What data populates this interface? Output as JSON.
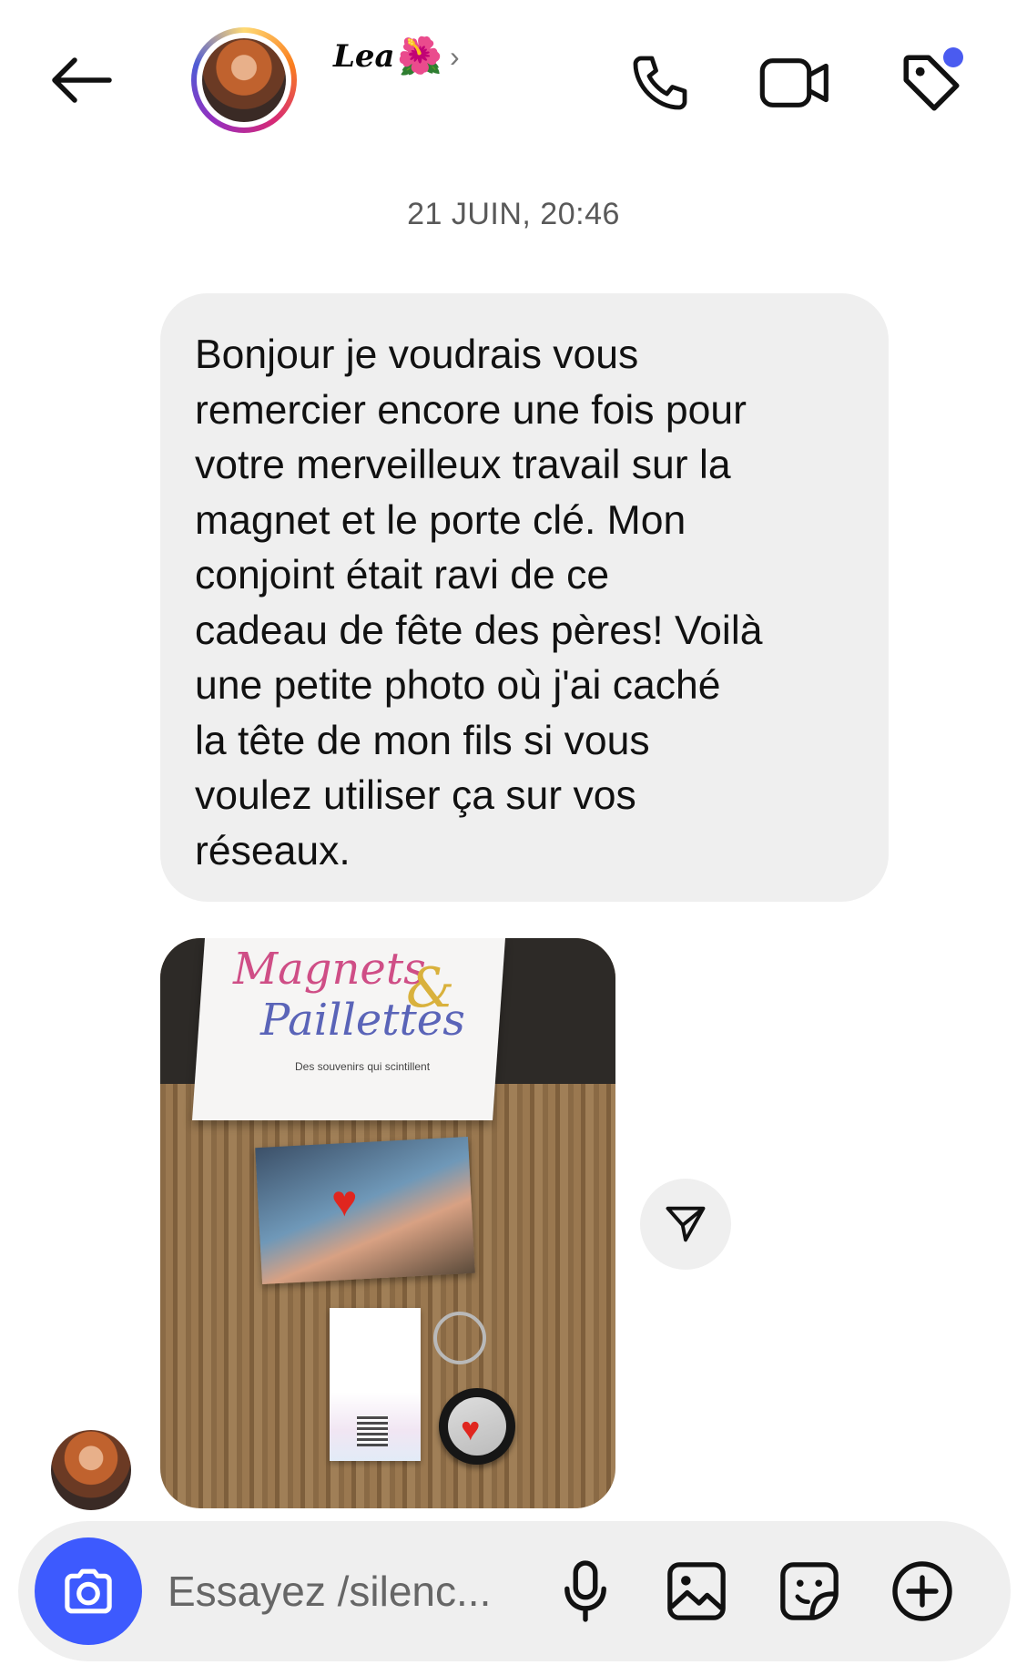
{
  "header": {
    "contact_name": "Lea",
    "name_emoji": "🌺",
    "chevron": "›",
    "icons": [
      "back-arrow-icon",
      "phone-icon",
      "video-camera-icon",
      "tag-icon"
    ],
    "notification_dot_color": "#4a5bf0"
  },
  "thread": {
    "timestamp": "21 JUIN, 20:46",
    "message_text": "Bonjour je voudrais vous\nremercier encore une fois pour\nvotre merveilleux travail sur la\nmagnet et le porte clé. Mon\nconjoint était ravi de ce\ncadeau de fête des pères! Voilà\nune petite photo où j'ai caché\nla tête de mon fils si vous\nvoulez utiliser ça sur vos\nréseaux.",
    "photo": {
      "brand_line1": "Magnets",
      "brand_amp": "&",
      "brand_line2": "Paillettes",
      "brand_tagline": "Des souvenirs qui scintillent",
      "heart": "♥"
    }
  },
  "composer": {
    "placeholder": "Essayez /silenc...",
    "camera_button_color": "#3d5afe",
    "icons": [
      "camera-icon",
      "microphone-icon",
      "gallery-icon",
      "sticker-icon",
      "plus-circle-icon"
    ]
  }
}
